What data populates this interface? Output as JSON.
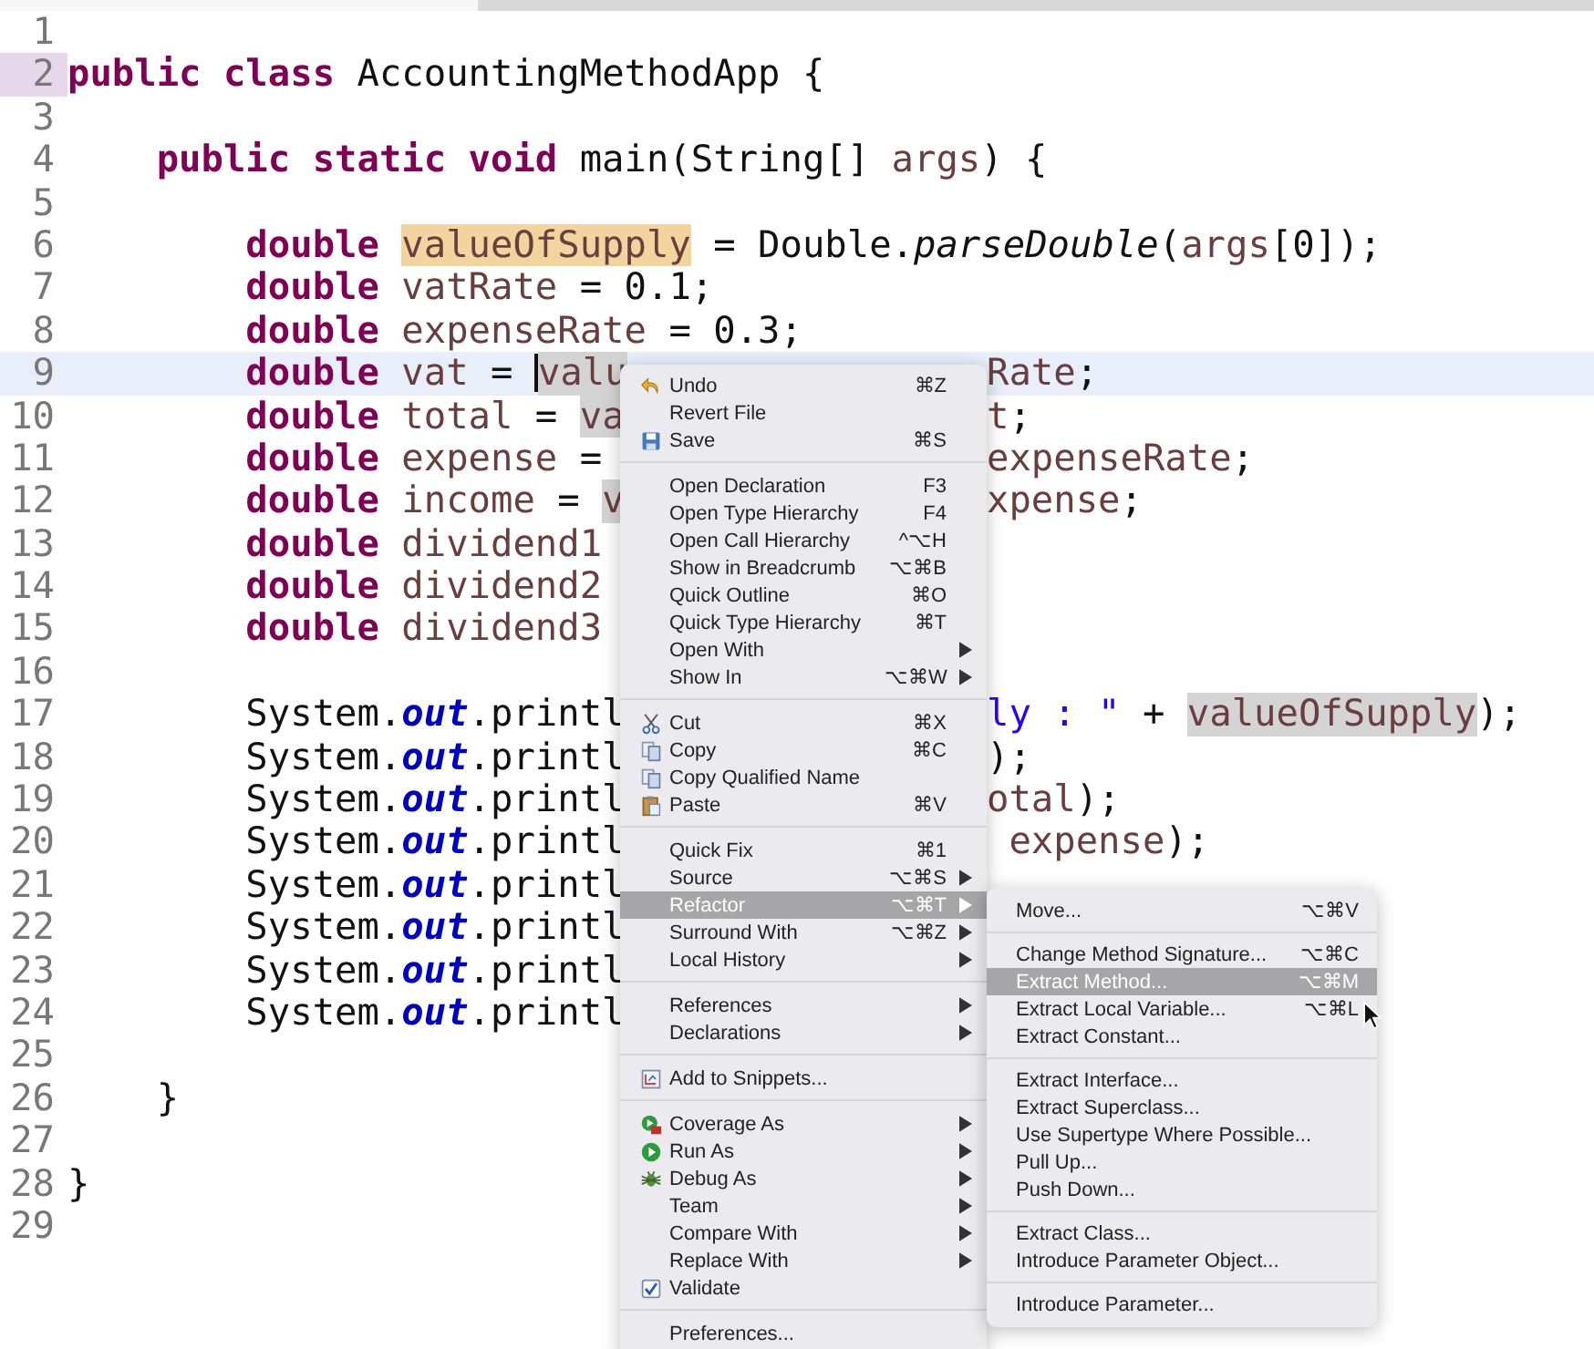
{
  "editor": {
    "lines": [
      {
        "number": "1"
      },
      {
        "number": "2",
        "marked": true,
        "left": [
          {
            "text": "public class ",
            "kind": "kw"
          },
          {
            "text": "AccountingMethodApp {",
            "kind": "plain"
          }
        ]
      },
      {
        "number": "3"
      },
      {
        "number": "4",
        "left": [
          {
            "text": "    public static void ",
            "kind": "kw"
          },
          {
            "text": "main(String[] ",
            "kind": "plain"
          },
          {
            "text": "args",
            "kind": "var"
          },
          {
            "text": ") {",
            "kind": "plain"
          }
        ]
      },
      {
        "number": "5"
      },
      {
        "number": "6",
        "left": [
          {
            "text": "        double ",
            "kind": "kw"
          },
          {
            "text": "valueOfSupply",
            "kind": "sel"
          },
          {
            "text": " = Double.",
            "kind": "plain"
          },
          {
            "text": "parseDouble",
            "kind": "italic"
          },
          {
            "text": "(",
            "kind": "plain"
          },
          {
            "text": "args",
            "kind": "var"
          },
          {
            "text": "[0]);",
            "kind": "plain"
          }
        ]
      },
      {
        "number": "7",
        "left": [
          {
            "text": "        double ",
            "kind": "kw"
          },
          {
            "text": "vatRate",
            "kind": "var"
          },
          {
            "text": " = 0.1;",
            "kind": "plain"
          }
        ]
      },
      {
        "number": "8",
        "left": [
          {
            "text": "        double ",
            "kind": "kw"
          },
          {
            "text": "expenseRate",
            "kind": "var"
          },
          {
            "text": " = 0.3;",
            "kind": "plain"
          }
        ]
      },
      {
        "number": "9",
        "current": true,
        "left": [
          {
            "text": "        double ",
            "kind": "kw"
          },
          {
            "text": "vat",
            "kind": "var"
          },
          {
            "text": " = ",
            "kind": "plain"
          },
          {
            "text": "valu",
            "kind": "occ",
            "caret": true
          }
        ],
        "right": [
          {
            "text": "Rate",
            "kind": "var"
          },
          {
            "text": ";",
            "kind": "plain"
          }
        ]
      },
      {
        "number": "10",
        "left": [
          {
            "text": "        double ",
            "kind": "kw"
          },
          {
            "text": "total",
            "kind": "var"
          },
          {
            "text": " = ",
            "kind": "plain"
          },
          {
            "text": "va",
            "kind": "occ"
          }
        ],
        "right": [
          {
            "text": "t",
            "kind": "var"
          },
          {
            "text": ";",
            "kind": "plain"
          }
        ]
      },
      {
        "number": "11",
        "left": [
          {
            "text": "        double ",
            "kind": "kw"
          },
          {
            "text": "expense",
            "kind": "var"
          },
          {
            "text": " =",
            "kind": "plain"
          }
        ],
        "right": [
          {
            "text": "expenseRate",
            "kind": "var"
          },
          {
            "text": ";",
            "kind": "plain"
          }
        ]
      },
      {
        "number": "12",
        "left": [
          {
            "text": "        double ",
            "kind": "kw"
          },
          {
            "text": "income",
            "kind": "var"
          },
          {
            "text": " = ",
            "kind": "plain"
          },
          {
            "text": "v",
            "kind": "occ"
          }
        ],
        "right": [
          {
            "text": "xpense",
            "kind": "var"
          },
          {
            "text": ";",
            "kind": "plain"
          }
        ]
      },
      {
        "number": "13",
        "left": [
          {
            "text": "        double ",
            "kind": "kw"
          },
          {
            "text": "dividend1",
            "kind": "var"
          }
        ]
      },
      {
        "number": "14",
        "left": [
          {
            "text": "        double ",
            "kind": "kw"
          },
          {
            "text": "dividend2",
            "kind": "var"
          }
        ]
      },
      {
        "number": "15",
        "left": [
          {
            "text": "        double ",
            "kind": "kw"
          },
          {
            "text": "dividend3",
            "kind": "var"
          }
        ]
      },
      {
        "number": "16"
      },
      {
        "number": "17",
        "left": [
          {
            "text": "        System.",
            "kind": "plain"
          },
          {
            "text": "out",
            "kind": "field"
          },
          {
            "text": ".printl",
            "kind": "plain"
          }
        ],
        "right": [
          {
            "text": "ly : \"",
            "kind": "str"
          },
          {
            "text": " + ",
            "kind": "plain"
          },
          {
            "text": "valueOfSupply",
            "kind": "occ"
          },
          {
            "text": ");",
            "kind": "plain"
          }
        ]
      },
      {
        "number": "18",
        "left": [
          {
            "text": "        System.",
            "kind": "plain"
          },
          {
            "text": "out",
            "kind": "field"
          },
          {
            "text": ".printl",
            "kind": "plain"
          }
        ],
        "right": [
          {
            "text": ");",
            "kind": "plain"
          }
        ]
      },
      {
        "number": "19",
        "left": [
          {
            "text": "        System.",
            "kind": "plain"
          },
          {
            "text": "out",
            "kind": "field"
          },
          {
            "text": ".printl",
            "kind": "plain"
          }
        ],
        "right": [
          {
            "text": "otal",
            "kind": "var"
          },
          {
            "text": ");",
            "kind": "plain"
          }
        ]
      },
      {
        "number": "20",
        "left": [
          {
            "text": "        System.",
            "kind": "plain"
          },
          {
            "text": "out",
            "kind": "field"
          },
          {
            "text": ".printl",
            "kind": "plain"
          }
        ],
        "right": [
          {
            "text": " expense",
            "kind": "var"
          },
          {
            "text": ");",
            "kind": "plain"
          }
        ]
      },
      {
        "number": "21",
        "left": [
          {
            "text": "        System.",
            "kind": "plain"
          },
          {
            "text": "out",
            "kind": "field"
          },
          {
            "text": ".printl",
            "kind": "plain"
          }
        ]
      },
      {
        "number": "22",
        "left": [
          {
            "text": "        System.",
            "kind": "plain"
          },
          {
            "text": "out",
            "kind": "field"
          },
          {
            "text": ".printl",
            "kind": "plain"
          }
        ]
      },
      {
        "number": "23",
        "left": [
          {
            "text": "        System.",
            "kind": "plain"
          },
          {
            "text": "out",
            "kind": "field"
          },
          {
            "text": ".printl",
            "kind": "plain"
          }
        ]
      },
      {
        "number": "24",
        "left": [
          {
            "text": "        System.",
            "kind": "plain"
          },
          {
            "text": "out",
            "kind": "field"
          },
          {
            "text": ".printl",
            "kind": "plain"
          }
        ]
      },
      {
        "number": "25"
      },
      {
        "number": "26",
        "left": [
          {
            "text": "    }",
            "kind": "plain"
          }
        ]
      },
      {
        "number": "27"
      },
      {
        "number": "28",
        "left": [
          {
            "text": "}",
            "kind": "plain"
          }
        ]
      },
      {
        "number": "29"
      }
    ]
  },
  "context_menu": {
    "items": [
      {
        "kind": "undo",
        "label": "Undo",
        "shortcut": "⌘Z",
        "selected": false
      },
      {
        "kind": "item",
        "label": "Revert File",
        "selected": false
      },
      {
        "kind": "save",
        "label": "Save",
        "shortcut": "⌘S",
        "selected": false
      },
      {
        "kind": "separator"
      },
      {
        "kind": "item",
        "label": "Open Declaration",
        "shortcut": "F3",
        "selected": false
      },
      {
        "kind": "item",
        "label": "Open Type Hierarchy",
        "shortcut": "F4",
        "selected": false
      },
      {
        "kind": "item",
        "label": "Open Call Hierarchy",
        "shortcut": "^⌥H",
        "selected": false
      },
      {
        "kind": "item",
        "label": "Show in Breadcrumb",
        "shortcut": "⌥⌘B",
        "selected": false
      },
      {
        "kind": "item",
        "label": "Quick Outline",
        "shortcut": "⌘O",
        "selected": false
      },
      {
        "kind": "item",
        "label": "Quick Type Hierarchy",
        "shortcut": "⌘T",
        "selected": false
      },
      {
        "kind": "item",
        "label": "Open With",
        "submenu": true,
        "selected": false
      },
      {
        "kind": "item",
        "label": "Show In",
        "shortcut": "⌥⌘W",
        "submenu": true,
        "selected": false
      },
      {
        "kind": "separator"
      },
      {
        "kind": "cut",
        "label": "Cut",
        "shortcut": "⌘X",
        "selected": false
      },
      {
        "kind": "copy",
        "label": "Copy",
        "shortcut": "⌘C",
        "selected": false
      },
      {
        "kind": "copy",
        "label": "Copy Qualified Name",
        "selected": false
      },
      {
        "kind": "paste",
        "label": "Paste",
        "shortcut": "⌘V",
        "selected": false
      },
      {
        "kind": "separator"
      },
      {
        "kind": "item",
        "label": "Quick Fix",
        "shortcut": "⌘1",
        "selected": false
      },
      {
        "kind": "item",
        "label": "Source",
        "shortcut": "⌥⌘S",
        "submenu": true,
        "selected": false
      },
      {
        "kind": "item",
        "label": "Refactor",
        "shortcut": "⌥⌘T",
        "submenu": true,
        "selected": true
      },
      {
        "kind": "item",
        "label": "Surround With",
        "shortcut": "⌥⌘Z",
        "submenu": true,
        "selected": false
      },
      {
        "kind": "item",
        "label": "Local History",
        "submenu": true,
        "selected": false
      },
      {
        "kind": "separator"
      },
      {
        "kind": "item",
        "label": "References",
        "submenu": true,
        "selected": false
      },
      {
        "kind": "item",
        "label": "Declarations",
        "submenu": true,
        "selected": false
      },
      {
        "kind": "separator"
      },
      {
        "kind": "snippet",
        "label": "Add to Snippets...",
        "selected": false
      },
      {
        "kind": "separator"
      },
      {
        "kind": "coverage",
        "label": "Coverage As",
        "submenu": true,
        "selected": false
      },
      {
        "kind": "run",
        "label": "Run As",
        "submenu": true,
        "selected": false
      },
      {
        "kind": "debug",
        "label": "Debug As",
        "submenu": true,
        "selected": false
      },
      {
        "kind": "item",
        "label": "Team",
        "submenu": true,
        "selected": false
      },
      {
        "kind": "item",
        "label": "Compare With",
        "submenu": true,
        "selected": false
      },
      {
        "kind": "item",
        "label": "Replace With",
        "submenu": true,
        "selected": false
      },
      {
        "kind": "checkbox",
        "label": "Validate",
        "checked": true,
        "selected": false
      },
      {
        "kind": "separator"
      },
      {
        "kind": "item",
        "label": "Preferences...",
        "selected": false
      }
    ]
  },
  "refactor_submenu": {
    "items": [
      {
        "kind": "item",
        "label": "Move...",
        "shortcut": "⌥⌘V",
        "selected": false
      },
      {
        "kind": "separator"
      },
      {
        "kind": "item",
        "label": "Change Method Signature...",
        "shortcut": "⌥⌘C",
        "selected": false
      },
      {
        "kind": "item",
        "label": "Extract Method...",
        "shortcut": "⌥⌘M",
        "selected": true
      },
      {
        "kind": "item",
        "label": "Extract Local Variable...",
        "shortcut": "⌥⌘L",
        "selected": false
      },
      {
        "kind": "item",
        "label": "Extract Constant...",
        "selected": false
      },
      {
        "kind": "separator"
      },
      {
        "kind": "item",
        "label": "Extract Interface...",
        "selected": false
      },
      {
        "kind": "item",
        "label": "Extract Superclass...",
        "selected": false
      },
      {
        "kind": "item",
        "label": "Use Supertype Where Possible...",
        "selected": false
      },
      {
        "kind": "item",
        "label": "Pull Up...",
        "selected": false
      },
      {
        "kind": "item",
        "label": "Push Down...",
        "selected": false
      },
      {
        "kind": "separator"
      },
      {
        "kind": "item",
        "label": "Extract Class...",
        "selected": false
      },
      {
        "kind": "item",
        "label": "Introduce Parameter Object...",
        "selected": false
      },
      {
        "kind": "separator"
      },
      {
        "kind": "item",
        "label": "Introduce Parameter...",
        "selected": false
      }
    ]
  }
}
